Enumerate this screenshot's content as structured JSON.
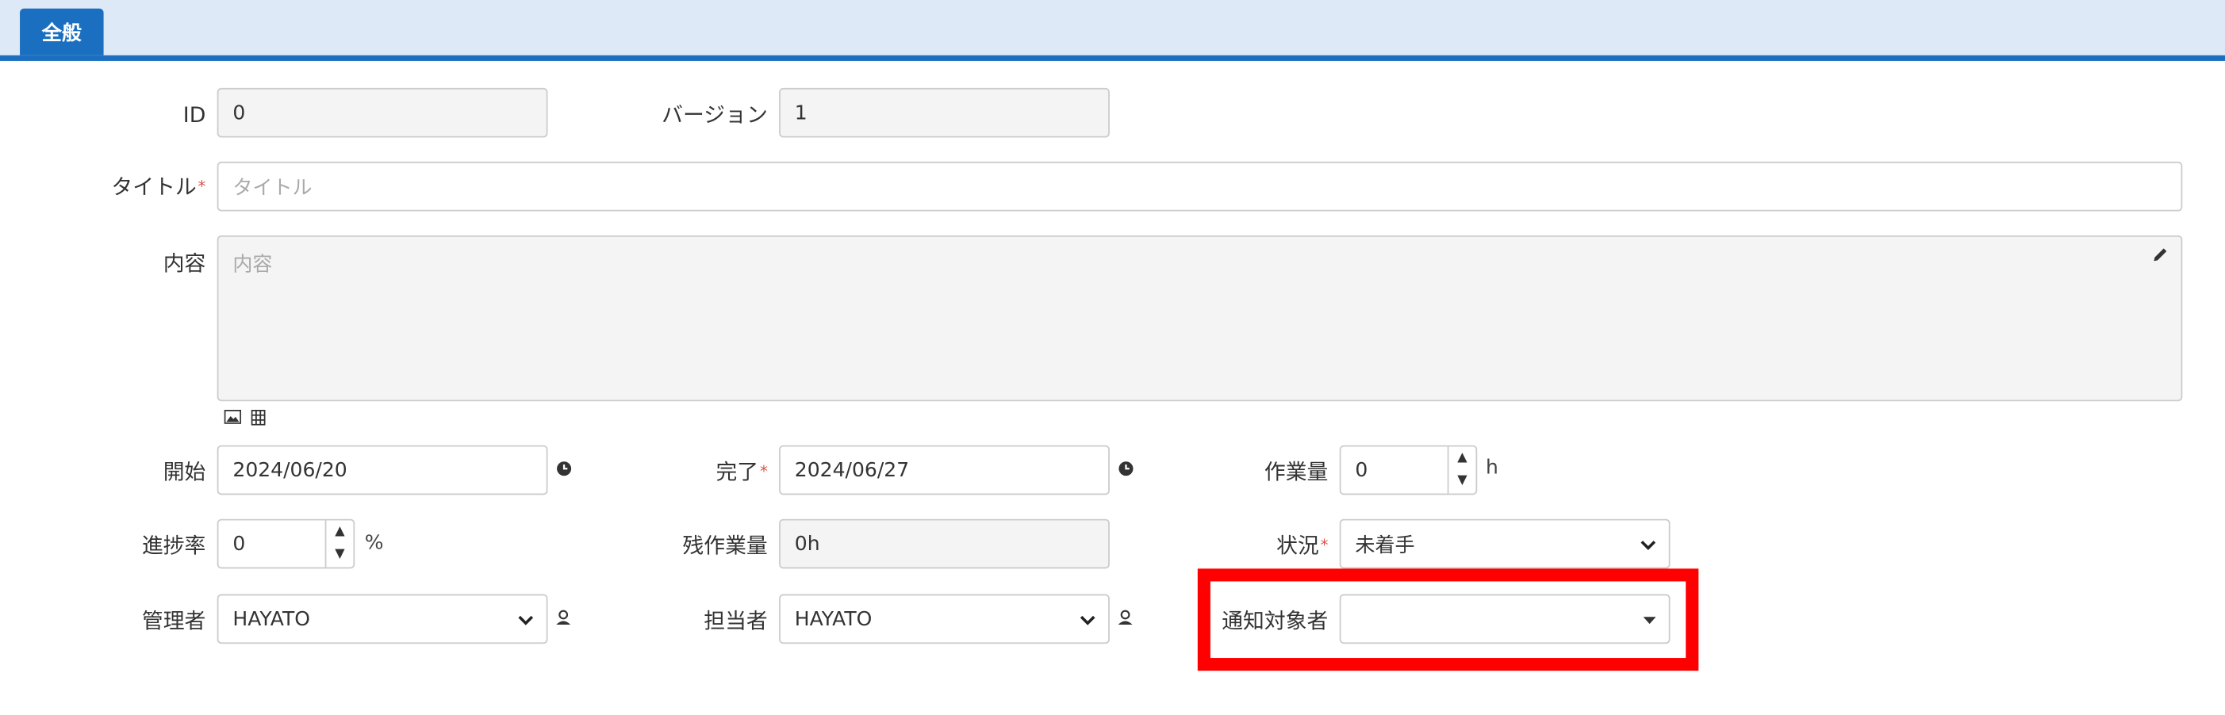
{
  "tabs": [
    {
      "label": "全般"
    }
  ],
  "form": {
    "id": {
      "label": "ID",
      "value": "0"
    },
    "version": {
      "label": "バージョン",
      "value": "1"
    },
    "title": {
      "label": "タイトル",
      "required": "*",
      "placeholder": "タイトル"
    },
    "content": {
      "label": "内容",
      "placeholder": "内容"
    },
    "start": {
      "label": "開始",
      "value": "2024/06/20"
    },
    "end": {
      "label": "完了",
      "required": "*",
      "value": "2024/06/27"
    },
    "workload": {
      "label": "作業量",
      "value": "0",
      "unit": "h"
    },
    "progress": {
      "label": "進捗率",
      "value": "0",
      "unit": "%"
    },
    "remaining": {
      "label": "残作業量",
      "value": "0h"
    },
    "status": {
      "label": "状況",
      "required": "*",
      "value": "未着手"
    },
    "manager": {
      "label": "管理者",
      "value": "HAYATO"
    },
    "owner": {
      "label": "担当者",
      "value": "HAYATO"
    },
    "notify": {
      "label": "通知対象者",
      "value": ""
    }
  },
  "icons": {
    "edit": "pencil-icon",
    "image": "image-icon",
    "attachment": "grid-icon",
    "clock": "clock-icon",
    "user": "user-icon",
    "spin_up": "▲",
    "spin_down": "▼",
    "dropdown": "▾"
  },
  "colors": {
    "accent": "#1b6fc1",
    "tabbar": "#dde9f7",
    "highlight": "#ff0000",
    "required": "#e0504a"
  }
}
